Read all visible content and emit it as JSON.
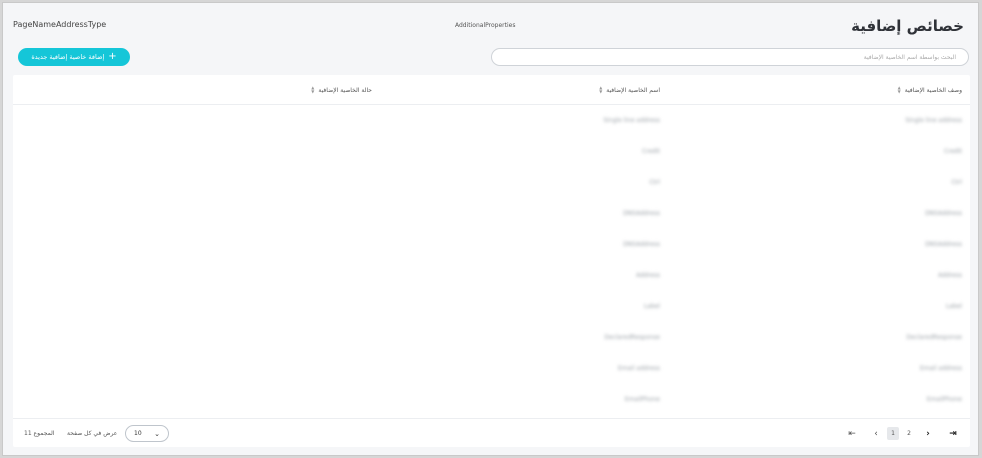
{
  "header": {
    "title": "خصائص إضافية",
    "breadcrumb_left": "PageNameAddressType",
    "breadcrumb_mid": "AdditionalProperties"
  },
  "search": {
    "placeholder": "البحث بواسطة اسم الخاصية الإضافية"
  },
  "add_button": {
    "label": "إضافة خاصية إضافية جديدة",
    "icon": "plus-icon"
  },
  "table": {
    "columns": [
      "وصف الخاصية الإضافية",
      "اسم الخاصية الإضافية",
      "حالة الخاصية الإضافية"
    ],
    "rows": [
      [
        "Single line address",
        "Single line address"
      ],
      [
        "Credit",
        "Credit"
      ],
      [
        "Ctrl",
        "Ctrl"
      ],
      [
        "DNSAddress",
        "DNSAddress"
      ],
      [
        "DNSAddress",
        "DNSAddress"
      ],
      [
        "Address",
        "Address"
      ],
      [
        "Label",
        "Label"
      ],
      [
        "DeclaredResponse",
        "DeclaredResponse"
      ],
      [
        "Email address",
        "Email address"
      ],
      [
        "EmailPhone",
        "EmailPhone"
      ]
    ]
  },
  "footer": {
    "total_label": "المجموع 11",
    "per_page_label": "عرض في كل صفحة",
    "per_page_value": "10",
    "pages": [
      "1",
      "2"
    ],
    "current_page": "1"
  }
}
